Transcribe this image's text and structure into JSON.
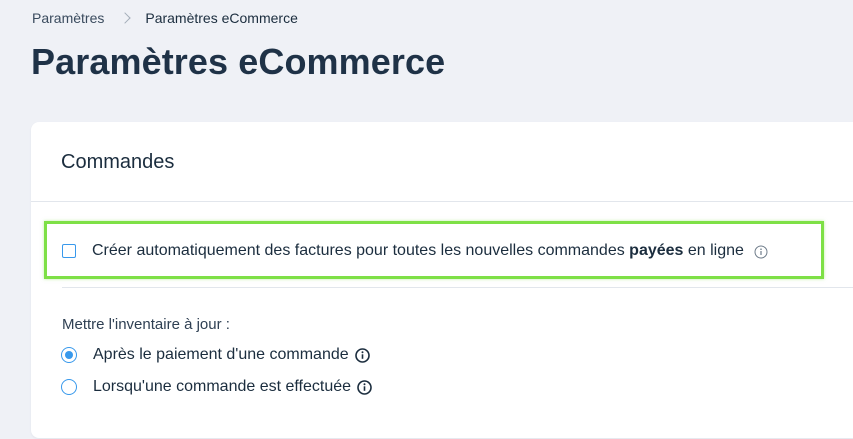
{
  "breadcrumb": {
    "parent": "Paramètres",
    "current": "Paramètres eCommerce"
  },
  "page": {
    "title": "Paramètres eCommerce"
  },
  "orders_card": {
    "title": "Commandes",
    "auto_invoice": {
      "text_before": "Créer automatiquement des factures pour toutes les nouvelles commandes ",
      "text_bold": "payées",
      "text_after": " en ligne",
      "checked": false,
      "info_icon": "info-outline-icon"
    },
    "inventory": {
      "label": "Mettre l'inventaire à jour :",
      "options": [
        {
          "label": "Après le paiement d'une commande",
          "selected": true,
          "info_icon": "info-solid-icon"
        },
        {
          "label": "Lorsqu'une commande est effectuée",
          "selected": false,
          "info_icon": "info-solid-icon"
        }
      ]
    }
  },
  "colors": {
    "accent": "#3899ec",
    "highlight": "#7ee046",
    "title": "#1f3247",
    "background": "#eff1f6"
  }
}
